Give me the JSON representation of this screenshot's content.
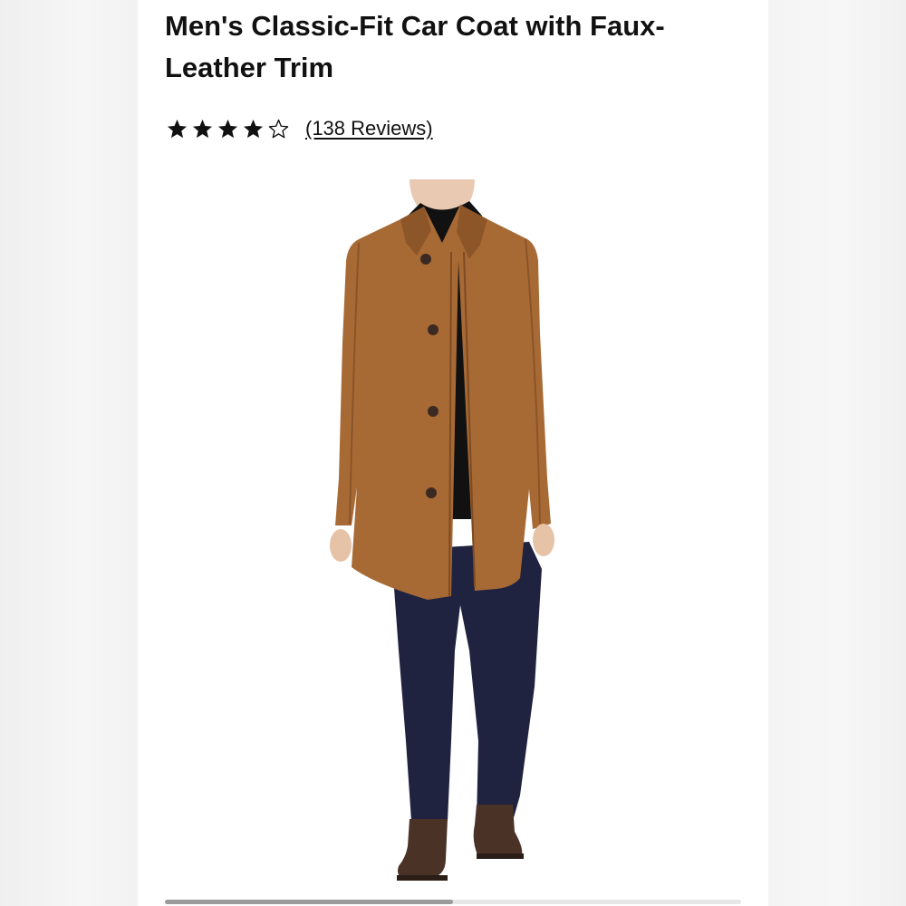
{
  "product": {
    "title": "Men's Classic-Fit Car Coat with Faux-Leather Trim",
    "rating": {
      "stars_filled": 4,
      "stars_total": 5,
      "reviews_label": "(138 Reviews)"
    },
    "image": {
      "subject": "product-photo",
      "coat_color": "#a86a35",
      "pants_color": "#1f2340",
      "turtleneck_color": "#111111",
      "boots_color": "#4a3326"
    }
  },
  "gallery": {
    "scroll_position_fraction": 0.5
  },
  "colors": {
    "text": "#111111",
    "page_bg": "#ffffff",
    "outer_bg": "#f4f4f4"
  }
}
